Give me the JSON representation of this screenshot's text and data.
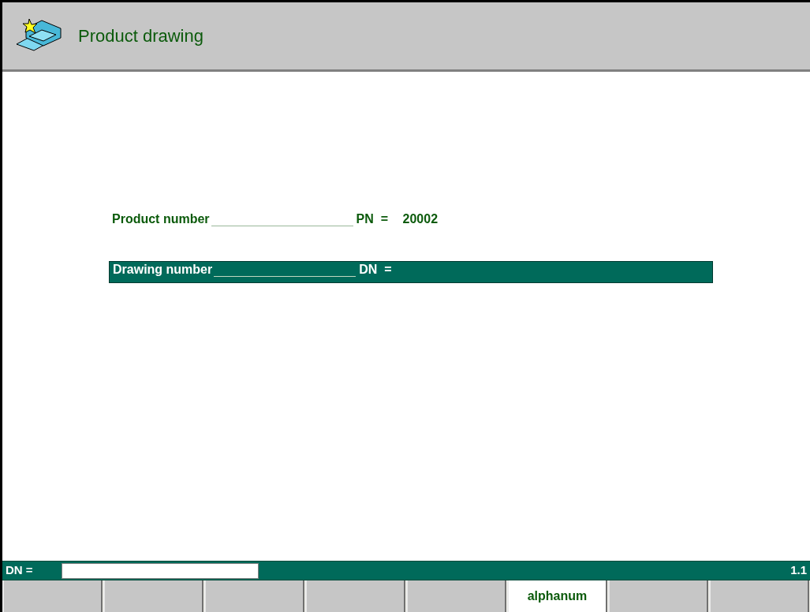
{
  "window": {
    "title": "Product drawing"
  },
  "fields": [
    {
      "label": "Product number",
      "code": "PN  =",
      "value": "20002",
      "selected": false
    },
    {
      "label": "Drawing number",
      "code": "DN  =",
      "selected": true
    }
  ],
  "status_bar": {
    "prompt": "DN =",
    "page": "1.1"
  },
  "softkeys": [
    {
      "selected": false
    },
    {
      "selected": false
    },
    {
      "selected": false
    },
    {
      "selected": false
    },
    {
      "selected": false
    },
    {
      "label": "alphanum",
      "selected": true
    },
    {
      "selected": false
    },
    {
      "selected": false
    }
  ]
}
